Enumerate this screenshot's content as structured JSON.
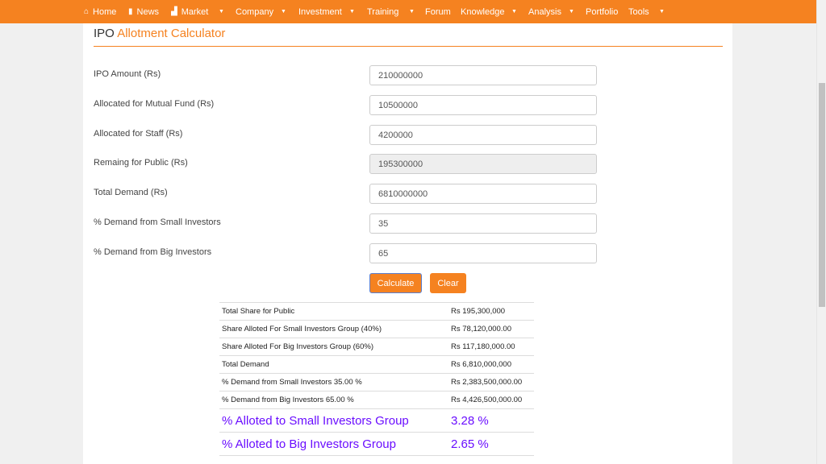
{
  "nav": {
    "items": [
      {
        "label": "Home",
        "icon": "home-icon",
        "glyph": "⌂",
        "caret": false
      },
      {
        "label": "News",
        "icon": "file-icon",
        "glyph": "▮",
        "caret": false
      },
      {
        "label": "Market",
        "icon": "chart-icon",
        "glyph": "▟",
        "caret": true
      },
      {
        "label": "Company",
        "caret": true
      },
      {
        "label": "Investment",
        "caret": true
      },
      {
        "label": "Training",
        "caret": true
      },
      {
        "label": "Forum",
        "caret": false
      },
      {
        "label": "Knowledge",
        "caret": true
      },
      {
        "label": "Analysis",
        "caret": true
      },
      {
        "label": "Portfolio",
        "caret": false
      },
      {
        "label": "Tools",
        "caret": true
      }
    ],
    "caret_glyph": "▼"
  },
  "page": {
    "title_prefix": "IPO",
    "title_accent": "Allotment Calculator"
  },
  "form": {
    "ipo_amount": {
      "label": "IPO Amount (Rs)",
      "value": "210000000"
    },
    "mutual_fund": {
      "label": "Allocated for Mutual Fund (Rs)",
      "value": "10500000"
    },
    "staff": {
      "label": "Allocated for Staff (Rs)",
      "value": "4200000"
    },
    "public": {
      "label": "Remaing for Public (Rs)",
      "value": "195300000"
    },
    "total_demand": {
      "label": "Total Demand (Rs)",
      "value": "6810000000"
    },
    "small_pct": {
      "label": "% Demand from Small Investors",
      "value": "35"
    },
    "big_pct": {
      "label": "% Demand from Big Investors",
      "value": "65"
    }
  },
  "buttons": {
    "calculate": "Calculate",
    "clear": "Clear"
  },
  "results": [
    {
      "label": "Total Share for Public",
      "value": "Rs 195,300,000"
    },
    {
      "label": "Share Alloted For Small Investors Group (40%)",
      "value": "Rs 78,120,000.00"
    },
    {
      "label": "Share Alloted For Big Investors Group (60%)",
      "value": "Rs 117,180,000.00"
    },
    {
      "label": "Total Demand",
      "value": "Rs 6,810,000,000"
    },
    {
      "label": "% Demand from Small Investors 35.00 %",
      "value": "Rs 2,383,500,000.00"
    },
    {
      "label": "% Demand from Big Investors 65.00 %",
      "value": "Rs 4,426,500,000.00"
    }
  ],
  "highlight": [
    {
      "label": "% Alloted to Small Investors Group",
      "value": "3.28 %"
    },
    {
      "label": "% Alloted to Big Investors Group",
      "value": "2.65 %"
    }
  ],
  "colors": {
    "accent": "#f58220",
    "highlight": "#6a0dff"
  }
}
